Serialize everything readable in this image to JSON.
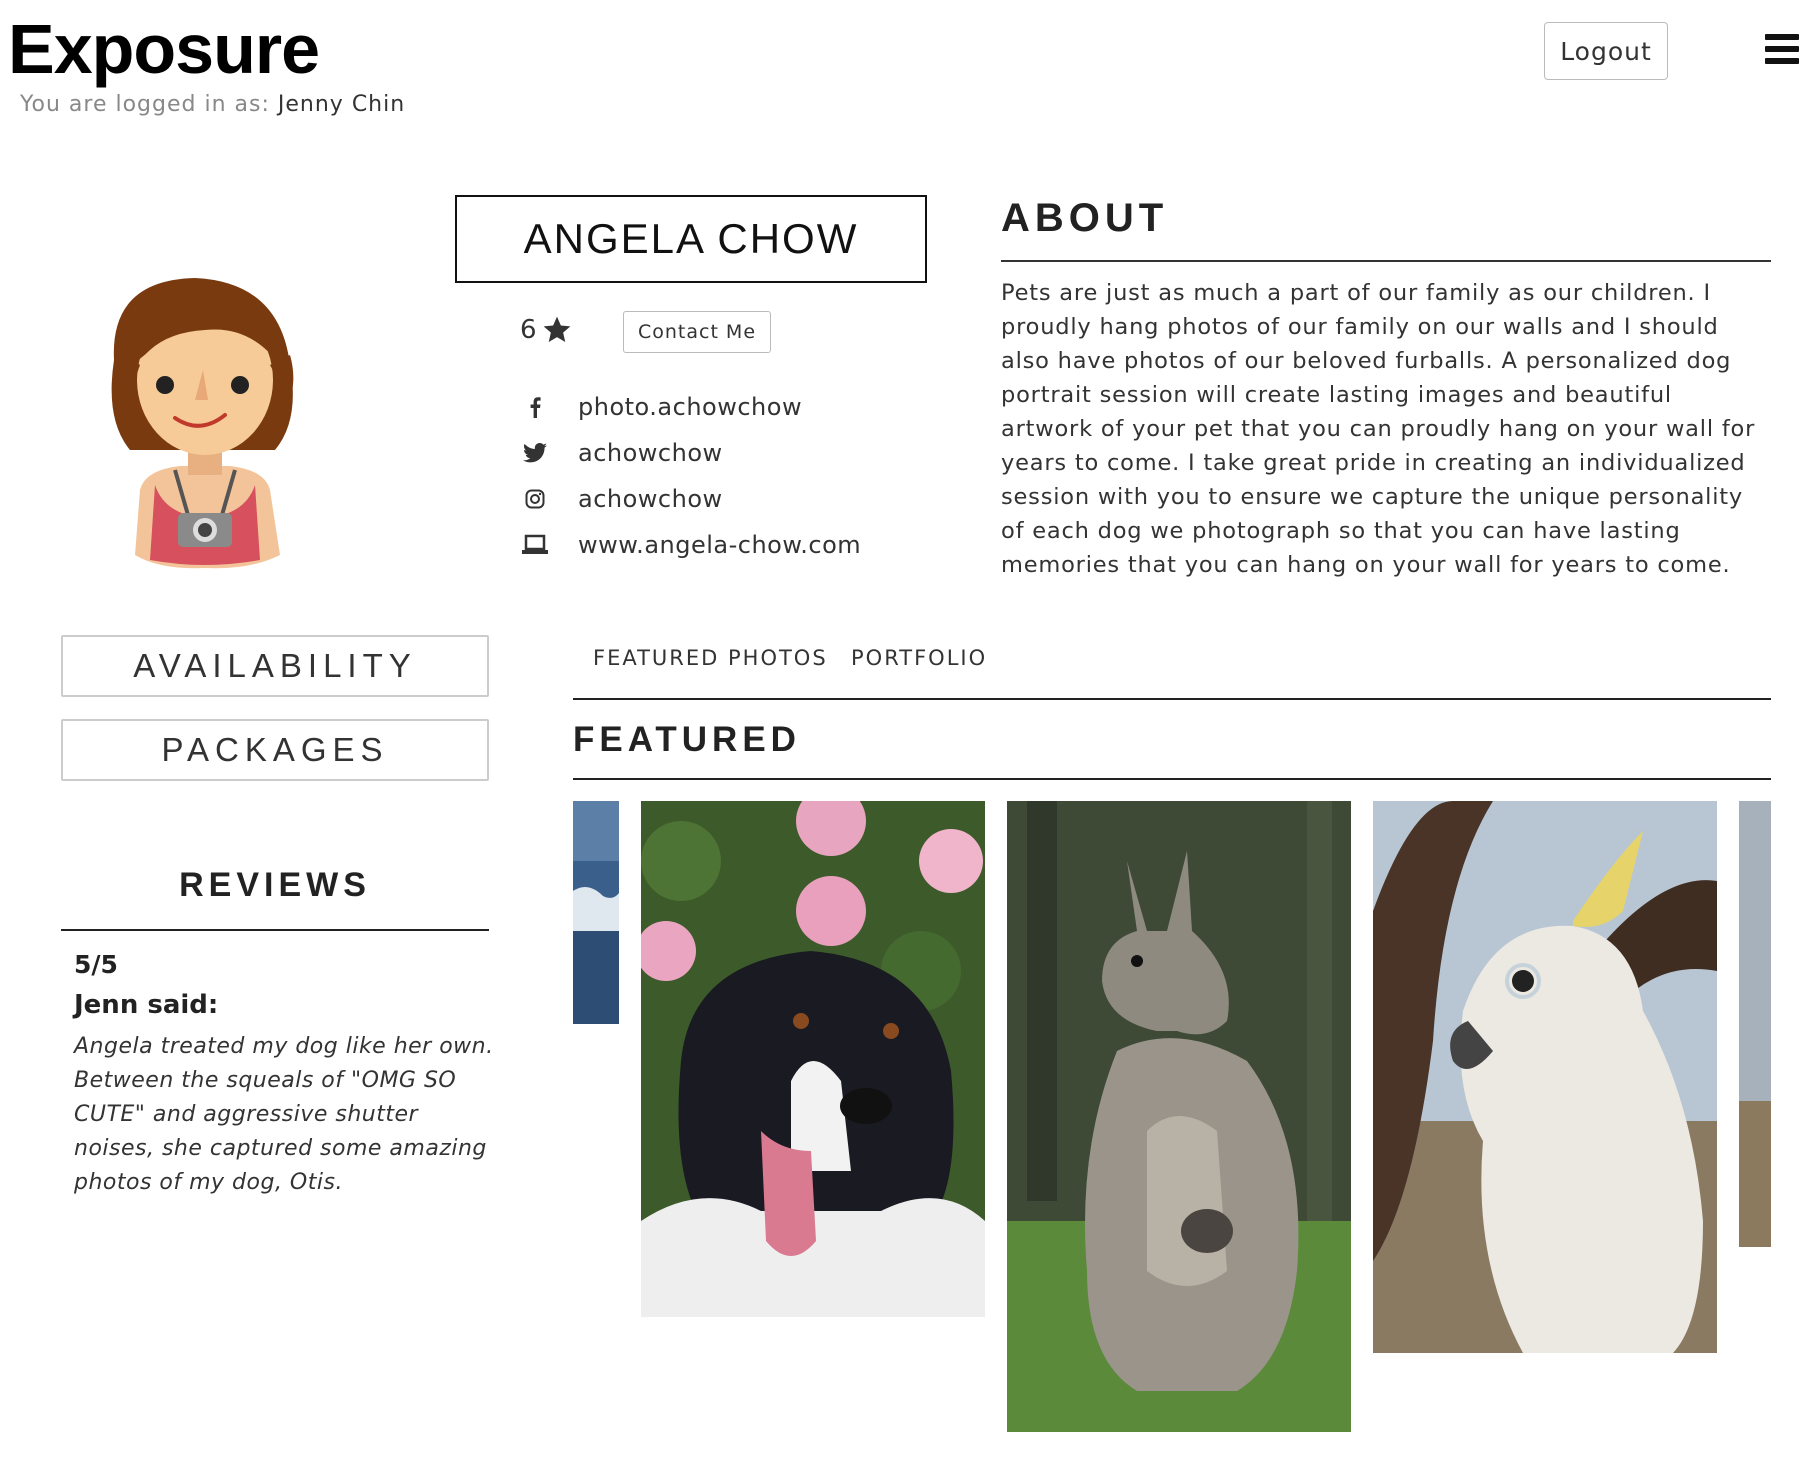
{
  "header": {
    "logo": "Exposure",
    "login_prefix": "You are logged in as:",
    "username": "Jenny Chin",
    "logout_label": "Logout"
  },
  "profile": {
    "name": "ANGELA CHOW",
    "rating": "6",
    "contact_label": "Contact Me",
    "social": [
      {
        "icon": "facebook-icon",
        "text": "photo.achowchow"
      },
      {
        "icon": "twitter-icon",
        "text": "achowchow"
      },
      {
        "icon": "instagram-icon",
        "text": "achowchow"
      },
      {
        "icon": "laptop-icon",
        "text": "www.angela-chow.com"
      }
    ]
  },
  "about": {
    "title": "ABOUT",
    "text": "Pets are just as much a part of our family as our children. I proudly hang photos of our family on our walls and I should also have photos of our beloved furballs. A personalized dog portrait session will create lasting images and beautiful artwork of your pet that you can proudly hang on your wall for years to come. I take great pride in creating an individualized session with you to ensure we capture the unique personality of each dog we photograph so that you can have lasting memories that you can hang on your wall for years to come."
  },
  "sidebar": {
    "availability_label": "AVAILABILITY",
    "packages_label": "PACKAGES"
  },
  "reviews": {
    "title": "REVIEWS",
    "items": [
      {
        "score": "5/5",
        "author": "Jenn said:",
        "text": "Angela treated my dog like her own. Between the squeals of \"OMG SO CUTE\" and aggressive shutter noises, she captured some amazing photos of my dog, Otis."
      }
    ]
  },
  "tabs": {
    "featured_photos": "FEATURED PHOTOS",
    "portfolio": "PORTFOLIO"
  },
  "featured": {
    "title": "FEATURED",
    "photos": [
      "ocean-photo",
      "dog-photo",
      "kangaroo-photo",
      "cockatoo-photo",
      "partial-photo"
    ]
  }
}
